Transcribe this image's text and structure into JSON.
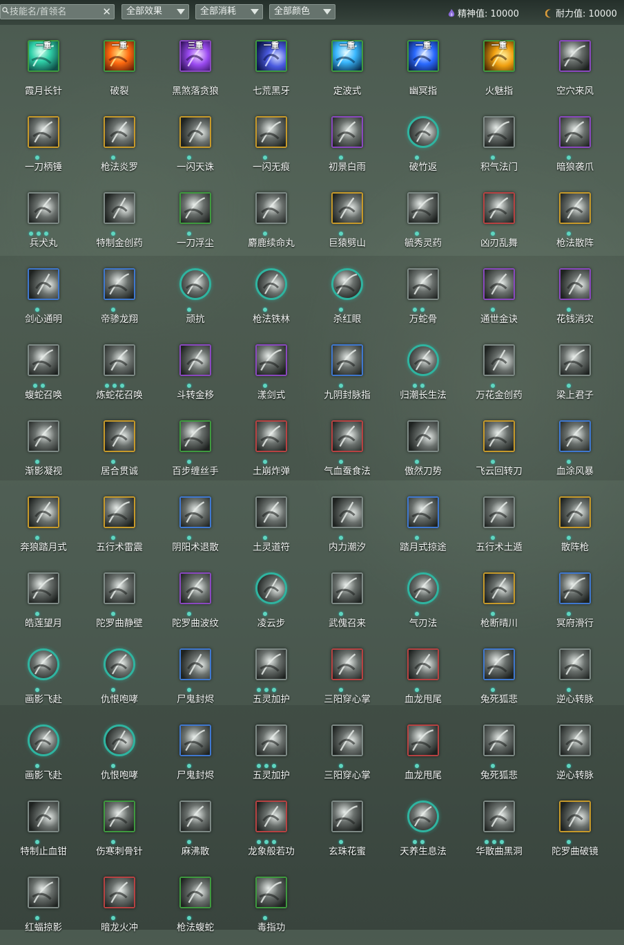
{
  "filters": {
    "search_placeholder": "技能名/首领名",
    "clear_label": "✕",
    "effect": "全部效果",
    "cost": "全部消耗",
    "color": "全部颜色"
  },
  "stats": {
    "spirit": "精神值: 10000",
    "stamina": "耐力值: 10000"
  },
  "colors": {
    "border_gold": "#c79a2a",
    "border_green": "#3f9a3f",
    "border_purple": "#8a48c0",
    "border_blue": "#3f78d0",
    "border_red": "#b84242",
    "border_gray": "#7e8a86",
    "round_teal": "#2fb4a0",
    "dot": "#5fd6c0"
  },
  "skills": [
    {
      "name": "霞月长针",
      "badge": "一重",
      "border": "green",
      "style": "color",
      "hue": "teal",
      "dots": 0
    },
    {
      "name": "破裂",
      "badge": "一重",
      "border": "green",
      "style": "color",
      "hue": "fire",
      "dots": 0
    },
    {
      "name": "黑煞落贪狼",
      "badge": "三重",
      "border": "purple",
      "style": "color",
      "hue": "violet",
      "dots": 0
    },
    {
      "name": "七荒黑牙",
      "badge": "一重",
      "border": "green",
      "style": "color",
      "hue": "indigo",
      "dots": 0
    },
    {
      "name": "定波式",
      "badge": "一重",
      "border": "green",
      "style": "color",
      "hue": "cyan",
      "dots": 0
    },
    {
      "name": "幽冥指",
      "badge": "一重",
      "border": "green",
      "style": "color",
      "hue": "blue",
      "dots": 0
    },
    {
      "name": "火魅指",
      "badge": "一重",
      "border": "green",
      "style": "color",
      "hue": "gold",
      "dots": 0
    },
    {
      "name": "空穴来风",
      "badge": "",
      "border": "purple",
      "style": "gray",
      "hue": "",
      "dots": 0
    },
    {
      "name": "一刀柄锤",
      "badge": "",
      "border": "gold",
      "style": "gray",
      "hue": "",
      "dots": 1
    },
    {
      "name": "枪法炎罗",
      "badge": "",
      "border": "gold",
      "style": "gray",
      "hue": "",
      "dots": 1
    },
    {
      "name": "一闪天诛",
      "badge": "",
      "border": "gold",
      "style": "gray",
      "hue": "",
      "dots": 1
    },
    {
      "name": "一闪无痕",
      "badge": "",
      "border": "gold",
      "style": "gray",
      "hue": "",
      "dots": 1
    },
    {
      "name": "初景白雨",
      "badge": "",
      "border": "purple",
      "style": "gray",
      "hue": "",
      "dots": 1
    },
    {
      "name": "破竹返",
      "badge": "",
      "border": "round",
      "style": "gray",
      "hue": "",
      "dots": 1
    },
    {
      "name": "积气法门",
      "badge": "",
      "border": "gray",
      "style": "gray",
      "hue": "",
      "dots": 1
    },
    {
      "name": "暗狼袭爪",
      "badge": "",
      "border": "purple",
      "style": "gray",
      "hue": "",
      "dots": 1
    },
    {
      "name": "兵犬丸",
      "badge": "",
      "border": "gray",
      "style": "gray",
      "hue": "",
      "dots": 3
    },
    {
      "name": "特制金创药",
      "badge": "",
      "border": "gray",
      "style": "gray",
      "hue": "",
      "dots": 1
    },
    {
      "name": "一刀浮尘",
      "badge": "",
      "border": "green",
      "style": "gray",
      "hue": "",
      "dots": 1
    },
    {
      "name": "麝鹿续命丸",
      "badge": "",
      "border": "gray",
      "style": "gray",
      "hue": "",
      "dots": 1
    },
    {
      "name": "巨猿劈山",
      "badge": "",
      "border": "gold",
      "style": "gray",
      "hue": "",
      "dots": 1
    },
    {
      "name": "毓秀灵药",
      "badge": "",
      "border": "gray",
      "style": "gray",
      "hue": "",
      "dots": 1
    },
    {
      "name": "凶刃乱舞",
      "badge": "",
      "border": "red",
      "style": "gray",
      "hue": "",
      "dots": 1
    },
    {
      "name": "枪法散阵",
      "badge": "",
      "border": "gold",
      "style": "gray",
      "hue": "",
      "dots": 1
    },
    {
      "name": "剑心通明",
      "badge": "",
      "border": "blue",
      "style": "gray",
      "hue": "",
      "dots": 1
    },
    {
      "name": "帝骖龙翔",
      "badge": "",
      "border": "blue",
      "style": "gray",
      "hue": "",
      "dots": 1
    },
    {
      "name": "顽抗",
      "badge": "",
      "border": "round",
      "style": "gray",
      "hue": "",
      "dots": 1
    },
    {
      "name": "枪法铁林",
      "badge": "",
      "border": "round",
      "style": "gray",
      "hue": "",
      "dots": 1
    },
    {
      "name": "杀红眼",
      "badge": "",
      "border": "round",
      "style": "gray",
      "hue": "",
      "dots": 1
    },
    {
      "name": "万蛇骨",
      "badge": "",
      "border": "gray",
      "style": "gray",
      "hue": "",
      "dots": 2
    },
    {
      "name": "通世金诀",
      "badge": "",
      "border": "purple",
      "style": "gray",
      "hue": "",
      "dots": 1
    },
    {
      "name": "花钱消灾",
      "badge": "",
      "border": "purple",
      "style": "gray",
      "hue": "",
      "dots": 1
    },
    {
      "name": "蝮蛇召唤",
      "badge": "",
      "border": "gray",
      "style": "gray",
      "hue": "",
      "dots": 2
    },
    {
      "name": "炼蛇花召唤",
      "badge": "",
      "border": "gray",
      "style": "gray",
      "hue": "",
      "dots": 3
    },
    {
      "name": "斗转金移",
      "badge": "",
      "border": "purple",
      "style": "gray",
      "hue": "",
      "dots": 1
    },
    {
      "name": "漾剑式",
      "badge": "",
      "border": "purple",
      "style": "gray",
      "hue": "",
      "dots": 1
    },
    {
      "name": "九阴封脉指",
      "badge": "",
      "border": "blue",
      "style": "gray",
      "hue": "",
      "dots": 1
    },
    {
      "name": "归潮长生法",
      "badge": "",
      "border": "round",
      "style": "gray",
      "hue": "",
      "dots": 2
    },
    {
      "name": "万花金创药",
      "badge": "",
      "border": "gray",
      "style": "gray",
      "hue": "",
      "dots": 1
    },
    {
      "name": "梁上君子",
      "badge": "",
      "border": "gray",
      "style": "gray",
      "hue": "",
      "dots": 1
    },
    {
      "name": "渐影凝视",
      "badge": "",
      "border": "gray",
      "style": "gray",
      "hue": "",
      "dots": 1
    },
    {
      "name": "居合贯诚",
      "badge": "",
      "border": "gold",
      "style": "gray",
      "hue": "",
      "dots": 1
    },
    {
      "name": "百步缠丝手",
      "badge": "",
      "border": "green",
      "style": "gray",
      "hue": "",
      "dots": 1
    },
    {
      "name": "土崩炸弹",
      "badge": "",
      "border": "red",
      "style": "gray",
      "hue": "",
      "dots": 1
    },
    {
      "name": "气血蚕食法",
      "badge": "",
      "border": "red",
      "style": "gray",
      "hue": "",
      "dots": 1
    },
    {
      "name": "傲然刀势",
      "badge": "",
      "border": "gray",
      "style": "gray",
      "hue": "",
      "dots": 1
    },
    {
      "name": "飞云回转刀",
      "badge": "",
      "border": "gold",
      "style": "gray",
      "hue": "",
      "dots": 1
    },
    {
      "name": "血涂风暴",
      "badge": "",
      "border": "blue",
      "style": "gray",
      "hue": "",
      "dots": 1
    },
    {
      "name": "奔狼踏月式",
      "badge": "",
      "border": "gold",
      "style": "gray",
      "hue": "",
      "dots": 1
    },
    {
      "name": "五行术雷震",
      "badge": "",
      "border": "gold",
      "style": "gray",
      "hue": "",
      "dots": 1
    },
    {
      "name": "阴阳术退散",
      "badge": "",
      "border": "blue",
      "style": "gray",
      "hue": "",
      "dots": 1
    },
    {
      "name": "土灵道符",
      "badge": "",
      "border": "gray",
      "style": "gray",
      "hue": "",
      "dots": 1
    },
    {
      "name": "内力潮汐",
      "badge": "",
      "border": "gray",
      "style": "gray",
      "hue": "",
      "dots": 1
    },
    {
      "name": "踏月式掠途",
      "badge": "",
      "border": "blue",
      "style": "gray",
      "hue": "",
      "dots": 1
    },
    {
      "name": "五行术土遁",
      "badge": "",
      "border": "gray",
      "style": "gray",
      "hue": "",
      "dots": 1
    },
    {
      "name": "散阵枪",
      "badge": "",
      "border": "gold",
      "style": "gray",
      "hue": "",
      "dots": 1
    },
    {
      "name": "皓莲望月",
      "badge": "",
      "border": "gray",
      "style": "gray",
      "hue": "",
      "dots": 1
    },
    {
      "name": "陀罗曲静壁",
      "badge": "",
      "border": "gray",
      "style": "gray",
      "hue": "",
      "dots": 1
    },
    {
      "name": "陀罗曲波纹",
      "badge": "",
      "border": "purple",
      "style": "gray",
      "hue": "",
      "dots": 1
    },
    {
      "name": "凌云步",
      "badge": "",
      "border": "round",
      "style": "gray",
      "hue": "",
      "dots": 1
    },
    {
      "name": "武傀召来",
      "badge": "",
      "border": "gray",
      "style": "gray",
      "hue": "",
      "dots": 1
    },
    {
      "name": "气刃法",
      "badge": "",
      "border": "round",
      "style": "gray",
      "hue": "",
      "dots": 1
    },
    {
      "name": "枪断晴川",
      "badge": "",
      "border": "gold",
      "style": "gray",
      "hue": "",
      "dots": 1
    },
    {
      "name": "冥府滑行",
      "badge": "",
      "border": "blue",
      "style": "gray",
      "hue": "",
      "dots": 1
    },
    {
      "name": "画影飞赴",
      "badge": "",
      "border": "round",
      "style": "gray",
      "hue": "",
      "dots": 1
    },
    {
      "name": "仇恨咆哮",
      "badge": "",
      "border": "round",
      "style": "gray",
      "hue": "",
      "dots": 1
    },
    {
      "name": "尸鬼封烬",
      "badge": "",
      "border": "blue",
      "style": "gray",
      "hue": "",
      "dots": 1
    },
    {
      "name": "五灵加护",
      "badge": "",
      "border": "gray",
      "style": "gray",
      "hue": "",
      "dots": 3
    },
    {
      "name": "三阳穿心掌",
      "badge": "",
      "border": "red",
      "style": "gray",
      "hue": "",
      "dots": 1
    },
    {
      "name": "血龙甩尾",
      "badge": "",
      "border": "red",
      "style": "gray",
      "hue": "",
      "dots": 1
    },
    {
      "name": "兔死狐悲",
      "badge": "",
      "border": "blue",
      "style": "gray",
      "hue": "",
      "dots": 1
    },
    {
      "name": "逆心转脉",
      "badge": "",
      "border": "gray",
      "style": "gray",
      "hue": "",
      "dots": 1
    },
    {
      "name": "画影飞赴",
      "badge": "",
      "border": "round",
      "style": "gray",
      "hue": "",
      "dots": 1
    },
    {
      "name": "仇恨咆哮",
      "badge": "",
      "border": "round",
      "style": "gray",
      "hue": "",
      "dots": 1
    },
    {
      "name": "尸鬼封烬",
      "badge": "",
      "border": "blue",
      "style": "gray",
      "hue": "",
      "dots": 1
    },
    {
      "name": "五灵加护",
      "badge": "",
      "border": "gray",
      "style": "gray",
      "hue": "",
      "dots": 3
    },
    {
      "name": "三阳穿心掌",
      "badge": "",
      "border": "gray",
      "style": "gray",
      "hue": "",
      "dots": 1
    },
    {
      "name": "血龙甩尾",
      "badge": "",
      "border": "red",
      "style": "gray",
      "hue": "",
      "dots": 1
    },
    {
      "name": "兔死狐悲",
      "badge": "",
      "border": "gray",
      "style": "gray",
      "hue": "",
      "dots": 1
    },
    {
      "name": "逆心转脉",
      "badge": "",
      "border": "gray",
      "style": "gray",
      "hue": "",
      "dots": 1
    },
    {
      "name": "特制止血钳",
      "badge": "",
      "border": "gray",
      "style": "gray",
      "hue": "",
      "dots": 1
    },
    {
      "name": "伤寒刺骨针",
      "badge": "",
      "border": "green",
      "style": "gray",
      "hue": "",
      "dots": 1
    },
    {
      "name": "麻沸散",
      "badge": "",
      "border": "gray",
      "style": "gray",
      "hue": "",
      "dots": 1
    },
    {
      "name": "龙象般若功",
      "badge": "",
      "border": "red",
      "style": "gray",
      "hue": "",
      "dots": 3
    },
    {
      "name": "玄珠花蜜",
      "badge": "",
      "border": "gray",
      "style": "gray",
      "hue": "",
      "dots": 1
    },
    {
      "name": "天养生息法",
      "badge": "",
      "border": "round",
      "style": "gray",
      "hue": "",
      "dots": 2
    },
    {
      "name": "华散曲黑洞",
      "badge": "",
      "border": "gray",
      "style": "gray",
      "hue": "",
      "dots": 3
    },
    {
      "name": "陀罗曲破镜",
      "badge": "",
      "border": "gold",
      "style": "gray",
      "hue": "",
      "dots": 1
    },
    {
      "name": "红蝠掠影",
      "badge": "",
      "border": "gray",
      "style": "gray",
      "hue": "",
      "dots": 1
    },
    {
      "name": "暗龙火冲",
      "badge": "",
      "border": "red",
      "style": "gray",
      "hue": "",
      "dots": 1
    },
    {
      "name": "枪法蝮蛇",
      "badge": "",
      "border": "green",
      "style": "gray",
      "hue": "",
      "dots": 1
    },
    {
      "name": "毒指功",
      "badge": "",
      "border": "green",
      "style": "gray",
      "hue": "",
      "dots": 1
    }
  ]
}
